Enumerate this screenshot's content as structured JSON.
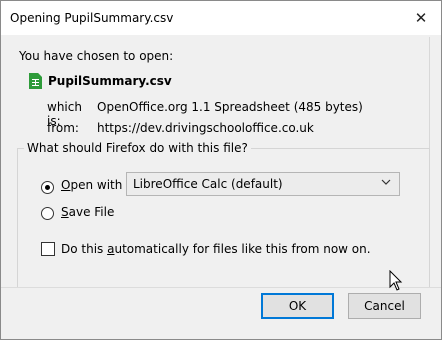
{
  "window": {
    "title": "Opening PupilSummary.csv",
    "close_glyph": "✕"
  },
  "intro": {
    "chosen_text": "You have chosen to open:",
    "file_name": "PupilSummary.csv",
    "which_label": "which is:",
    "which_value": "OpenOffice.org 1.1 Spreadsheet (485 bytes)",
    "from_label": "from:",
    "from_value": "https://dev.drivingschooloffice.co.uk"
  },
  "action_group": {
    "legend": "What should Firefox do with this file?",
    "open_with": {
      "mnemonic": "O",
      "rest": "pen with",
      "selected": true,
      "app": "LibreOffice Calc (default)"
    },
    "save_file": {
      "mnemonic": "S",
      "rest": "ave File",
      "selected": false
    },
    "auto": {
      "pre": "Do this ",
      "mnemonic": "a",
      "rest": "utomatically for files like this from now on.",
      "checked": false
    }
  },
  "buttons": {
    "ok": "OK",
    "cancel": "Cancel"
  },
  "colors": {
    "file_icon": "#2e9b3a",
    "focus_border": "#0078d7"
  },
  "icons": {
    "file": "spreadsheet-file-icon",
    "dropdown": "chevron-down-icon",
    "close": "close-icon",
    "cursor": "mouse-cursor"
  }
}
